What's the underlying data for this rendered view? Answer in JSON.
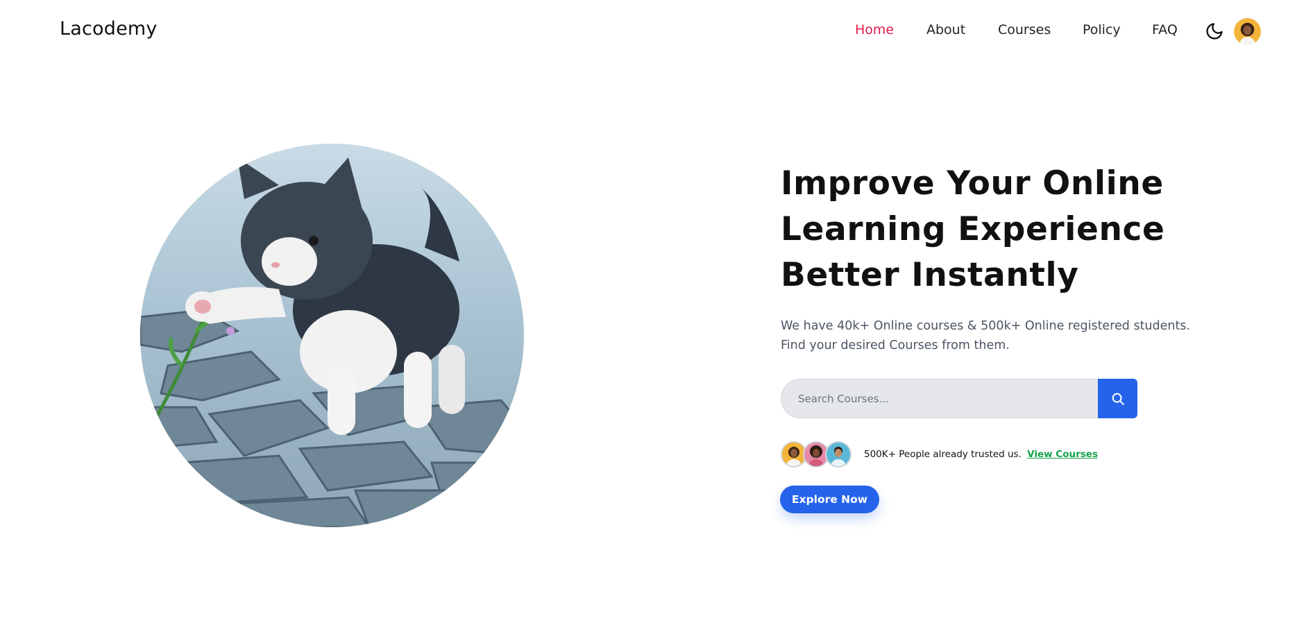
{
  "header": {
    "logo": "Lacodemy",
    "nav": [
      {
        "label": "Home",
        "active": true
      },
      {
        "label": "About",
        "active": false
      },
      {
        "label": "Courses",
        "active": false
      },
      {
        "label": "Policy",
        "active": false
      },
      {
        "label": "FAQ",
        "active": false
      }
    ],
    "theme_icon": "moon-icon",
    "avatar_icon": "user-avatar"
  },
  "hero": {
    "image": "kitten-playing-with-flower-photo",
    "title_lines": [
      "Improve Your Online",
      "Learning Experience",
      "Better Instantly"
    ],
    "subtitle": "We have 40k+ Online courses & 500k+ Online registered students. Find your desired Courses from them.",
    "search": {
      "placeholder": "Search Courses...",
      "value": "",
      "button_icon": "search-icon"
    },
    "trust": {
      "text": "500K+ People already trusted us.",
      "link": "View Courses"
    },
    "cta": "Explore Now"
  },
  "colors": {
    "accent": "#2563eb",
    "active_nav": "#e11d48",
    "link": "#16a34a"
  }
}
